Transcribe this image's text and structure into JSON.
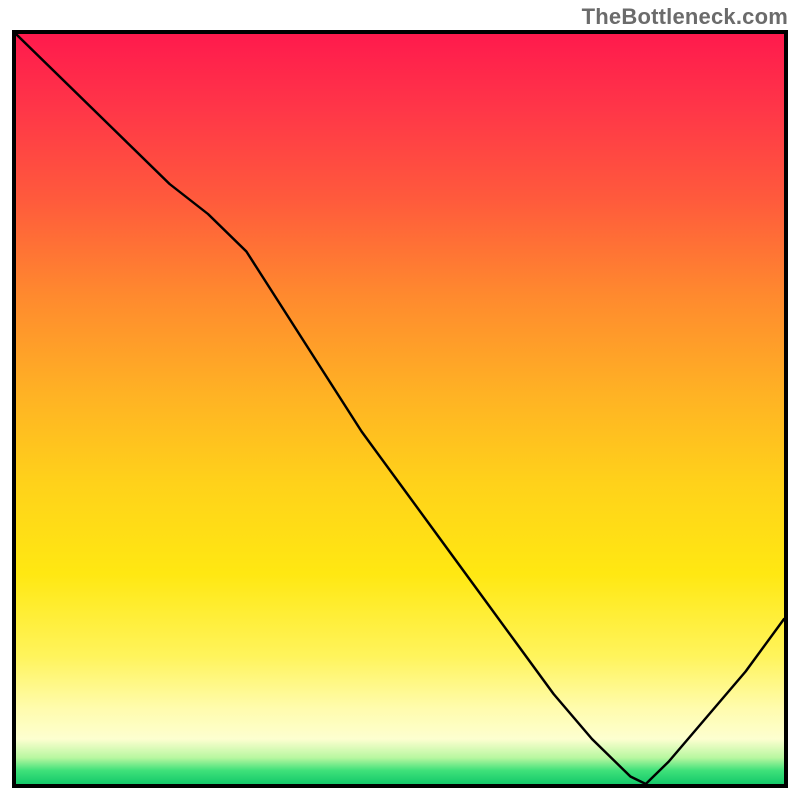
{
  "watermark": "TheBottleneck.com",
  "chart_data": {
    "type": "line",
    "title": "",
    "xlabel": "",
    "ylabel": "",
    "xlim": [
      0,
      1
    ],
    "ylim": [
      0,
      1
    ],
    "grid": false,
    "background": "rainbow-vertical-gradient-red-to-green",
    "series": [
      {
        "name": "bottleneck-curve",
        "stroke": "#000000",
        "x": [
          0.0,
          0.05,
          0.1,
          0.15,
          0.2,
          0.25,
          0.3,
          0.35,
          0.4,
          0.45,
          0.5,
          0.55,
          0.6,
          0.65,
          0.7,
          0.75,
          0.8,
          0.82,
          0.85,
          0.9,
          0.95,
          1.0
        ],
        "y": [
          1.0,
          0.95,
          0.9,
          0.85,
          0.8,
          0.76,
          0.71,
          0.63,
          0.55,
          0.47,
          0.4,
          0.33,
          0.26,
          0.19,
          0.12,
          0.06,
          0.01,
          0.0,
          0.03,
          0.09,
          0.15,
          0.22
        ]
      }
    ],
    "annotations": [
      {
        "name": "valley-label",
        "x": 0.81,
        "y": 0.0,
        "text": ""
      }
    ]
  }
}
